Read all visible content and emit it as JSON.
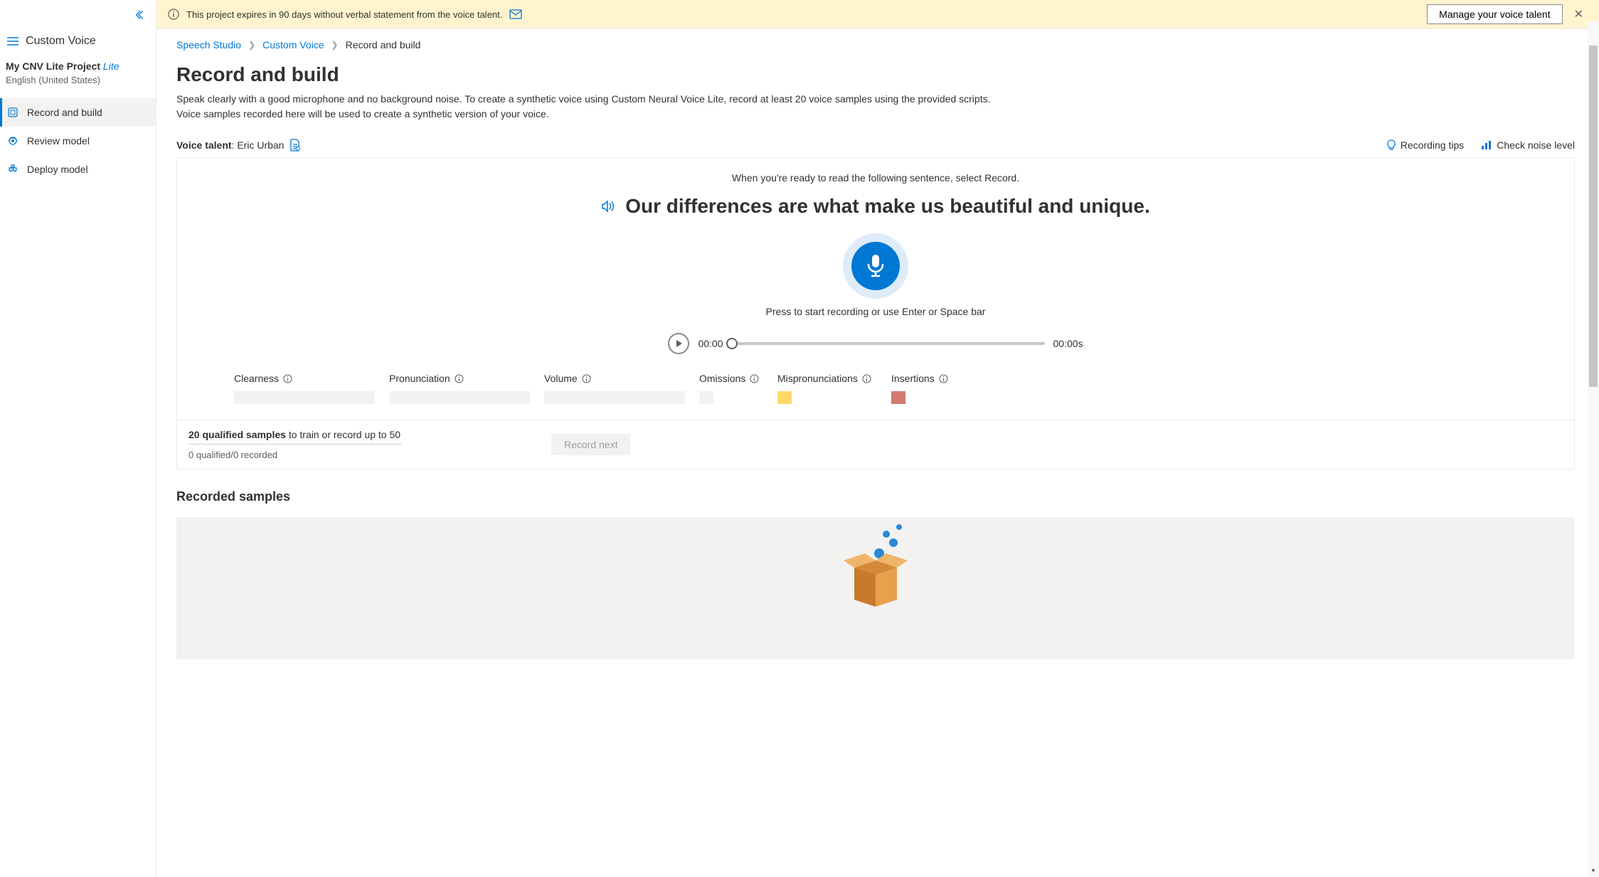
{
  "sidebar": {
    "app_title": "Custom Voice",
    "project_name": "My CNV Lite Project",
    "project_badge": "Lite",
    "project_lang": "English (United States)",
    "items": [
      {
        "label": "Record and build",
        "active": true
      },
      {
        "label": "Review model",
        "active": false
      },
      {
        "label": "Deploy model",
        "active": false
      }
    ]
  },
  "banner": {
    "text": "This project expires in 90 days without verbal statement from the voice talent.",
    "manage_label": "Manage your voice talent"
  },
  "breadcrumb": {
    "items": [
      "Speech Studio",
      "Custom Voice",
      "Record and build"
    ]
  },
  "page": {
    "title": "Record and build",
    "description": "Speak clearly with a good microphone and no background noise. To create a synthetic voice using Custom Neural Voice Lite, record at least 20 voice samples using the provided scripts. Voice samples recorded here will be used to create a synthetic version of your voice."
  },
  "talent": {
    "label": "Voice talent",
    "name": "Eric Urban",
    "tips_label": "Recording tips",
    "noise_label": "Check noise level"
  },
  "recorder": {
    "hint": "When you're ready to read the following sentence, select Record.",
    "sentence": "Our differences are what make us beautiful and unique.",
    "mic_hint": "Press to start recording or use Enter or Space bar",
    "time_current": "00:00",
    "time_total": "00:00s",
    "metrics": {
      "clearness": "Clearness",
      "pronunciation": "Pronunciation",
      "volume": "Volume",
      "omissions": "Omissions",
      "mispronunciations": "Mispronunciations",
      "insertions": "Insertions"
    }
  },
  "footer": {
    "qualified_bold": "20 qualified samples",
    "qualified_rest": " to train or record up to 50",
    "sub": "0 qualified/0 recorded",
    "record_next": "Record next"
  },
  "samples": {
    "title": "Recorded samples"
  }
}
